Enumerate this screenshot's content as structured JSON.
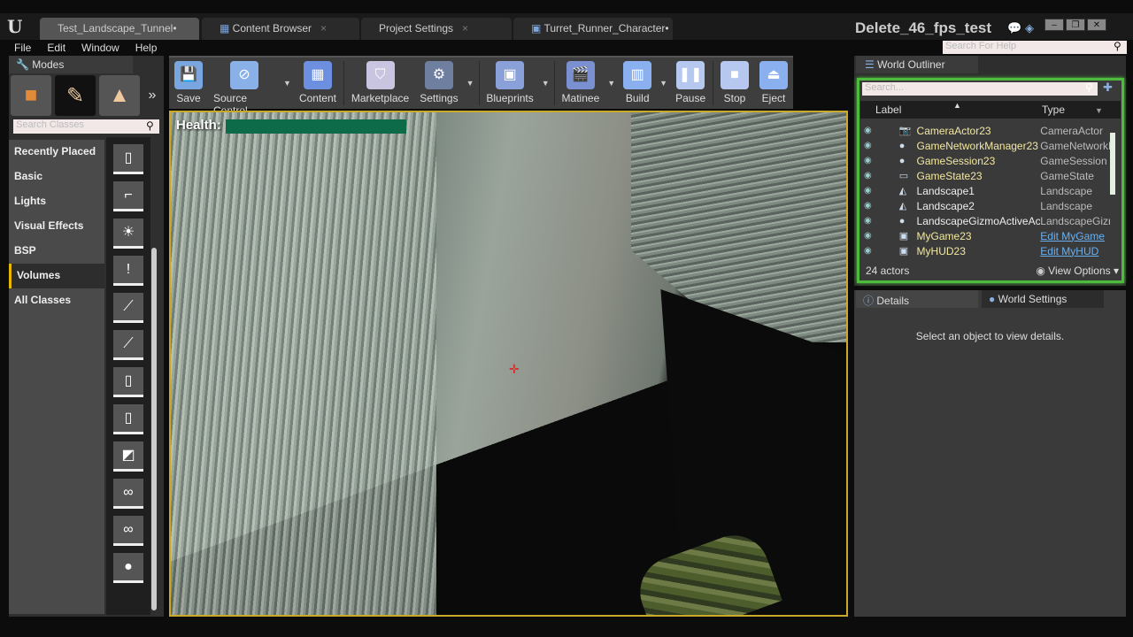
{
  "app": {
    "logo": "U",
    "project": "Delete_46_fps_test"
  },
  "tabs": [
    {
      "label": "Test_Landscape_Tunnel•",
      "active": true
    },
    {
      "label": "Content Browser"
    },
    {
      "label": "Project Settings"
    },
    {
      "label": "Turret_Runner_Character•"
    }
  ],
  "menu": [
    "File",
    "Edit",
    "Window",
    "Help"
  ],
  "help_search": {
    "placeholder": "Search For Help"
  },
  "modes": {
    "title": "Modes",
    "search_placeholder": "Search Classes",
    "categories": [
      "Recently Placed",
      "Basic",
      "Lights",
      "Visual Effects",
      "BSP",
      "Volumes",
      "All Classes"
    ],
    "selected": "Volumes"
  },
  "toolbar": [
    {
      "label": "Save",
      "icon": "save-icon",
      "color": "#7aa6e0"
    },
    {
      "label": "Source Control",
      "icon": "source-control-icon",
      "color": "#8ab0e8",
      "dropdown": true
    },
    {
      "label": "Content",
      "icon": "content-icon",
      "color": "#6c8fe0"
    },
    {
      "label": "Marketplace",
      "icon": "marketplace-icon",
      "color": "#c9c4e0"
    },
    {
      "label": "Settings",
      "icon": "settings-icon",
      "color": "#6f7fa0",
      "dropdown": true
    },
    {
      "label": "Blueprints",
      "icon": "blueprints-icon",
      "color": "#8aa0d8",
      "dropdown": true
    },
    {
      "label": "Matinee",
      "icon": "matinee-icon",
      "color": "#7b90d0",
      "dropdown": true
    },
    {
      "label": "Build",
      "icon": "build-icon",
      "color": "#8ab0f0",
      "dropdown": true
    },
    {
      "label": "Pause",
      "icon": "pause-icon",
      "color": "#b7c8f0"
    },
    {
      "label": "Stop",
      "icon": "stop-icon",
      "color": "#b7c8f0"
    },
    {
      "label": "Eject",
      "icon": "eject-icon",
      "color": "#8ab0f0"
    }
  ],
  "viewport": {
    "health_label": "Health:",
    "health_value": 1.0,
    "health_color": "#0d6b4a"
  },
  "outliner": {
    "title": "World Outliner",
    "search_placeholder": "Search...",
    "col_label": "Label",
    "col_type": "Type",
    "rows": [
      {
        "label": "CameraActor23",
        "type": "CameraActor",
        "icon": "camera-icon",
        "yellow": true
      },
      {
        "label": "GameNetworkManager23",
        "type": "GameNetworkM",
        "icon": "sphere-icon",
        "yellow": true
      },
      {
        "label": "GameSession23",
        "type": "GameSession",
        "icon": "sphere-icon",
        "yellow": true
      },
      {
        "label": "GameState23",
        "type": "GameState",
        "icon": "monitor-icon",
        "yellow": true
      },
      {
        "label": "Landscape1",
        "type": "Landscape",
        "icon": "landscape-icon"
      },
      {
        "label": "Landscape2",
        "type": "Landscape",
        "icon": "landscape-icon"
      },
      {
        "label": "LandscapeGizmoActiveActor",
        "type": "LandscapeGizr",
        "icon": "sphere-icon"
      },
      {
        "label": "MyGame23",
        "type": "Edit MyGame",
        "icon": "game-icon",
        "yellow": true,
        "link": true
      },
      {
        "label": "MyHUD23",
        "type": "Edit MyHUD",
        "icon": "hud-icon",
        "yellow": true,
        "link": true
      }
    ],
    "count": "24 actors",
    "view_options": "View Options"
  },
  "details": {
    "tabs": [
      "Details",
      "World Settings"
    ],
    "message": "Select an object to view details."
  }
}
